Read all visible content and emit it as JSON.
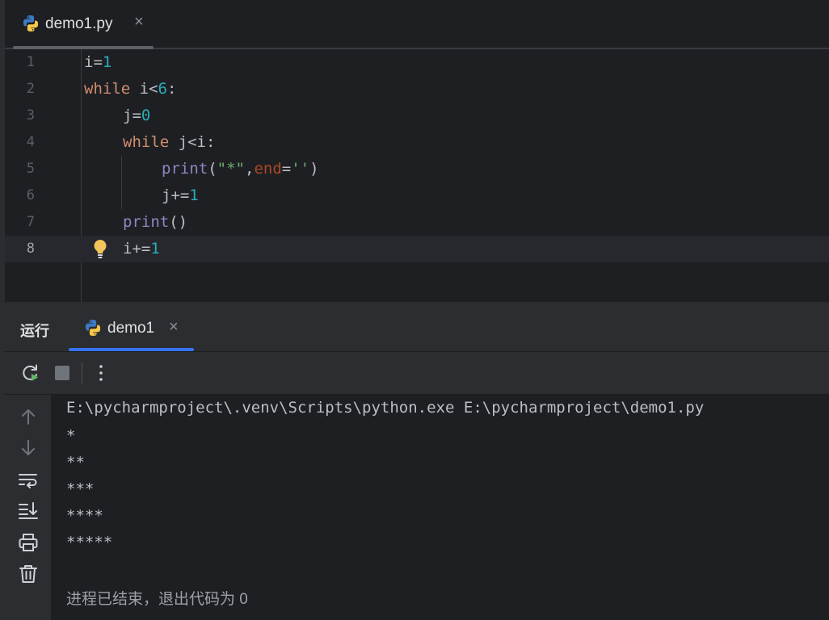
{
  "editor_tab": {
    "filename": "demo1.py",
    "close": "×"
  },
  "code": {
    "line_numbers": [
      "1",
      "2",
      "3",
      "4",
      "5",
      "6",
      "7",
      "8"
    ],
    "l1": {
      "a": "i=",
      "b": "1"
    },
    "l2": {
      "kw": "while",
      "a": " i<",
      "b": "6",
      "c": ":"
    },
    "l3": {
      "a": "j=",
      "b": "0"
    },
    "l4": {
      "kw": "while",
      "a": " j<i:"
    },
    "l5": {
      "fn": "print",
      "a": "(",
      "s": "\"*\"",
      "b": ",",
      "p": "end",
      "c": "=",
      "s2": "''",
      "d": ")"
    },
    "l6": {
      "a": "j+=",
      "b": "1"
    },
    "l7": {
      "fn": "print",
      "a": "()"
    },
    "l8": {
      "a": "i+=",
      "b": "1"
    }
  },
  "run_panel": {
    "label": "运行",
    "tab": {
      "name": "demo1",
      "close": "×"
    }
  },
  "console": {
    "command": "E:\\pycharmproject\\.venv\\Scripts\\python.exe E:\\pycharmproject\\demo1.py",
    "output": [
      "*",
      "**",
      "***",
      "****",
      "*****"
    ],
    "exit_message": "进程已结束，退出代码为 0"
  },
  "colors": {
    "keyword": "#cf8e6d",
    "number": "#2aacb8",
    "builtin": "#8888c6",
    "string": "#6aab73",
    "param": "#aa4926",
    "accent": "#3574f0"
  },
  "icons": [
    "python-icon",
    "bulb-icon",
    "rerun-icon",
    "stop-icon",
    "more-icon",
    "up-arrow-icon",
    "down-arrow-icon",
    "soft-wrap-icon",
    "scroll-to-end-icon",
    "print-icon",
    "trash-icon"
  ]
}
